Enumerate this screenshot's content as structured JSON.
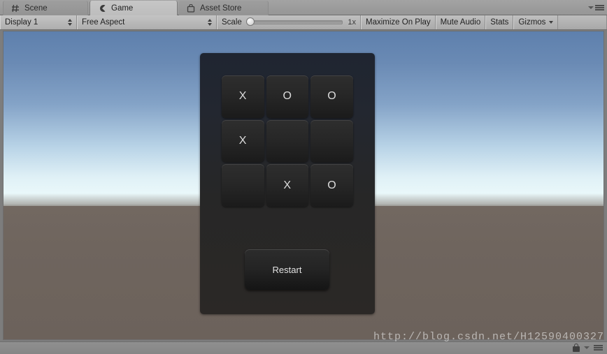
{
  "tabs": [
    {
      "label": "Scene",
      "icon": "grid-icon",
      "active": false
    },
    {
      "label": "Game",
      "icon": "pacman-icon",
      "active": true
    },
    {
      "label": "Asset Store",
      "icon": "shopping-bag-icon",
      "active": false
    }
  ],
  "toolbar": {
    "display": "Display 1",
    "aspect": "Free Aspect",
    "scale_label": "Scale",
    "scale_value": "1x",
    "maximize_on_play": "Maximize On Play",
    "mute_audio": "Mute Audio",
    "stats": "Stats",
    "gizmos": "Gizmos"
  },
  "game": {
    "board": {
      "rows": [
        [
          "X",
          "O",
          "O"
        ],
        [
          "X",
          "",
          ""
        ],
        [
          "",
          "X",
          "O"
        ]
      ]
    },
    "restart_label": "Restart"
  },
  "watermark": "http://blog.csdn.net/H12590400327",
  "colors": {
    "sky_top": "#5e80ad",
    "sky_horizon": "#eaf8fa",
    "ground": "#6c625b",
    "panel": "#272727",
    "cell": "#272727",
    "mark_text": "#dcdcdc"
  }
}
